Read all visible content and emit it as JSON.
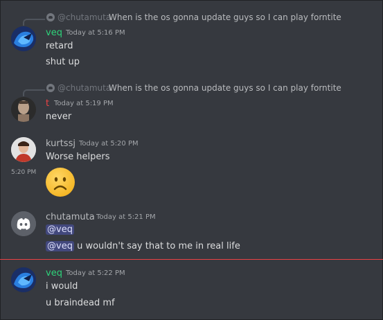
{
  "messages": [
    {
      "reply": {
        "name": "@chutamuta",
        "text": "When is the os gonna update guys so I can play forntite"
      },
      "author": "veq",
      "author_color": "#2ed37a",
      "timestamp": "Today at 5:16 PM",
      "lines": [
        "retard",
        "shut up"
      ]
    },
    {
      "reply": {
        "name": "@chutamuta",
        "text": "When is the os gonna update guys so I can play forntite"
      },
      "author": "t",
      "author_color": "#ed4245",
      "timestamp": "Today at 5:19 PM",
      "lines": [
        "never"
      ]
    },
    {
      "author": "kurtssj",
      "author_color": "#b9bbbe",
      "timestamp": "Today at 5:20 PM",
      "lines": [
        "Worse helpers"
      ],
      "side_time": "5:20 PM",
      "emoji": "frowning-face"
    },
    {
      "author": "chutamuta",
      "author_color": "#b9bbbe",
      "timestamp": "Today at 5:21 PM",
      "mention": "@veq",
      "line2_mention": "@veq",
      "line2_text": " u wouldn't say that to me in real life"
    },
    {
      "author": "veq",
      "author_color": "#2ed37a",
      "timestamp": "Today at 5:22 PM",
      "lines": [
        "i would",
        "u braindead mf"
      ]
    }
  ],
  "colors": {
    "background": "#36393f",
    "new_divider": "#ed4245",
    "discord_blurple": "#5865f2"
  }
}
